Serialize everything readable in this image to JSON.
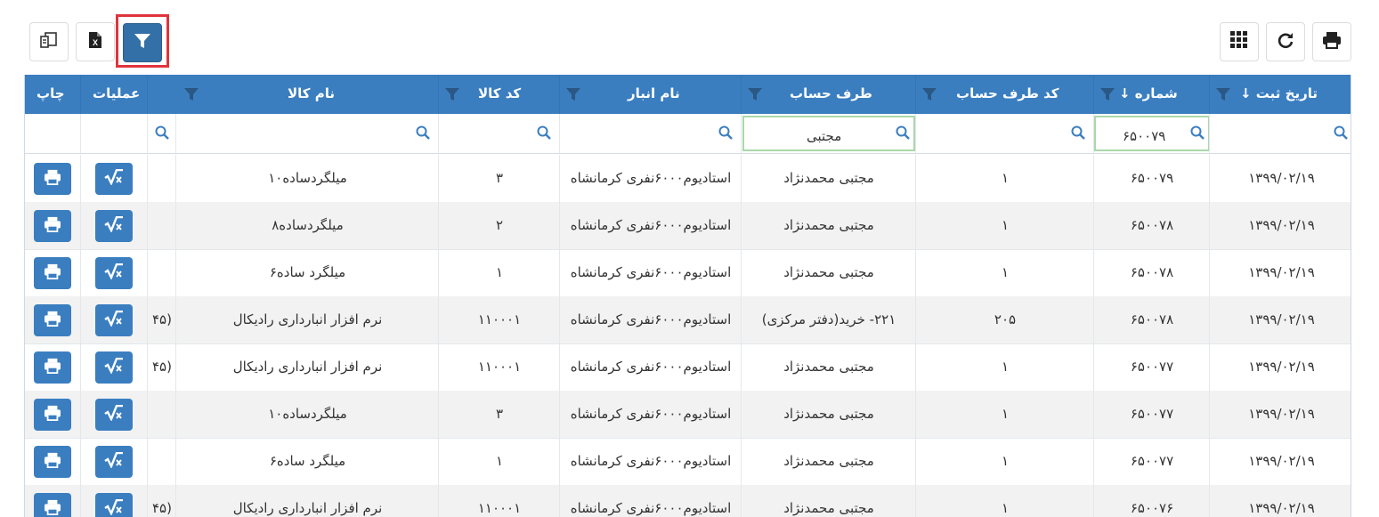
{
  "toolbar": {
    "left_buttons": [
      {
        "name": "columns-toggle-button",
        "icon": "columns-icon"
      },
      {
        "name": "excel-export-button",
        "icon": "excel-file-icon"
      },
      {
        "name": "filter-button",
        "icon": "funnel-icon",
        "active": true
      }
    ],
    "right_buttons": [
      {
        "name": "grid-layout-button",
        "icon": "grid-icon"
      },
      {
        "name": "refresh-button",
        "icon": "refresh-icon"
      },
      {
        "name": "print-button",
        "icon": "printer-icon"
      }
    ]
  },
  "colors": {
    "header": "#3a7ec0",
    "active_button": "#3370a8",
    "highlight": "#e0343c",
    "filter_active_border": "#a9d8a9"
  },
  "columns": {
    "date": "تاریخ ثبت ↓",
    "number": "شماره ↓",
    "account_code": "کد طرف حساب",
    "account": "طرف حساب",
    "warehouse": "نام انبار",
    "item_code": "کد کالا",
    "item_name": "نام کالا",
    "operations": "عملیات",
    "print": "چاپ"
  },
  "filters": {
    "number": "۶۵۰۰۷۹",
    "account": "مجتبی"
  },
  "rows": [
    {
      "date": "۱۳۹۹/۰۲/۱۹",
      "number": "۶۵۰۰۷۹",
      "account_code": "۱",
      "account": "مجتبی محمدنژاد",
      "warehouse": "استادیوم۶۰۰۰نفری کرمانشاه",
      "item_code": "۳",
      "item_name": "میلگردساده۱۰",
      "extra": ""
    },
    {
      "date": "۱۳۹۹/۰۲/۱۹",
      "number": "۶۵۰۰۷۸",
      "account_code": "۱",
      "account": "مجتبی محمدنژاد",
      "warehouse": "استادیوم۶۰۰۰نفری کرمانشاه",
      "item_code": "۲",
      "item_name": "میلگردساده۸",
      "extra": ""
    },
    {
      "date": "۱۳۹۹/۰۲/۱۹",
      "number": "۶۵۰۰۷۸",
      "account_code": "۱",
      "account": "مجتبی محمدنژاد",
      "warehouse": "استادیوم۶۰۰۰نفری کرمانشاه",
      "item_code": "۱",
      "item_name": "میلگرد ساده۶",
      "extra": ""
    },
    {
      "date": "۱۳۹۹/۰۲/۱۹",
      "number": "۶۵۰۰۷۸",
      "account_code": "۲۰۵",
      "account": "۲۲۱- خرید(دفتر مرکزی)",
      "warehouse": "استادیوم۶۰۰۰نفری کرمانشاه",
      "item_code": "۱۱۰۰۰۱",
      "item_name": "نرم افزار انبارداری رادیکال",
      "extra": "(۴۵"
    },
    {
      "date": "۱۳۹۹/۰۲/۱۹",
      "number": "۶۵۰۰۷۷",
      "account_code": "۱",
      "account": "مجتبی محمدنژاد",
      "warehouse": "استادیوم۶۰۰۰نفری کرمانشاه",
      "item_code": "۱۱۰۰۰۱",
      "item_name": "نرم افزار انبارداری رادیکال",
      "extra": "(۴۵"
    },
    {
      "date": "۱۳۹۹/۰۲/۱۹",
      "number": "۶۵۰۰۷۷",
      "account_code": "۱",
      "account": "مجتبی محمدنژاد",
      "warehouse": "استادیوم۶۰۰۰نفری کرمانشاه",
      "item_code": "۳",
      "item_name": "میلگردساده۱۰",
      "extra": ""
    },
    {
      "date": "۱۳۹۹/۰۲/۱۹",
      "number": "۶۵۰۰۷۷",
      "account_code": "۱",
      "account": "مجتبی محمدنژاد",
      "warehouse": "استادیوم۶۰۰۰نفری کرمانشاه",
      "item_code": "۱",
      "item_name": "میلگرد ساده۶",
      "extra": ""
    },
    {
      "date": "۱۳۹۹/۰۲/۱۹",
      "number": "۶۵۰۰۷۶",
      "account_code": "۱",
      "account": "مجتبی محمدنژاد",
      "warehouse": "استادیوم۶۰۰۰نفری کرمانشاه",
      "item_code": "۱۱۰۰۰۱",
      "item_name": "نرم افزار انبارداری رادیکال",
      "extra": "(۴۵"
    }
  ]
}
